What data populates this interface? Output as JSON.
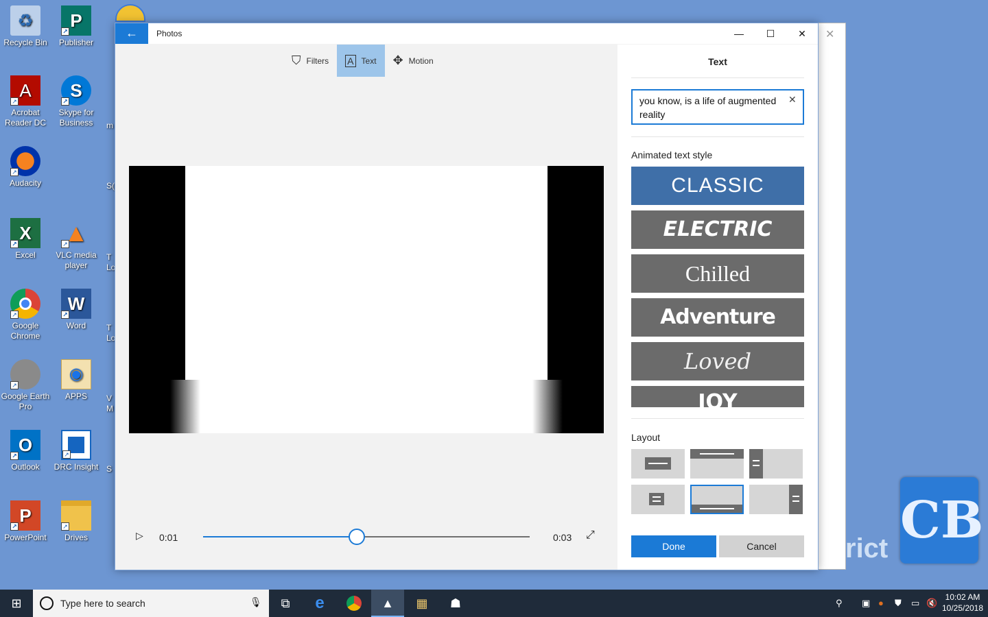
{
  "desktop": {
    "icons": [
      {
        "label": "Recycle Bin",
        "glyph": "♻",
        "color": "#9fb8d8"
      },
      {
        "label": "Publisher",
        "glyph": "P",
        "color": "#077568"
      },
      {
        "label": "Acrobat Reader DC",
        "glyph": "A",
        "color": "#b30b00"
      },
      {
        "label": "Skype for Business",
        "glyph": "S",
        "color": "#0078d7"
      },
      {
        "label": "Audacity",
        "glyph": "♫",
        "color": "#f2b705"
      },
      {
        "label": "Excel",
        "glyph": "X",
        "color": "#1d6f42"
      },
      {
        "label": "VLC media player",
        "glyph": "▲",
        "color": "#f58220"
      },
      {
        "label": "Google Chrome",
        "glyph": "◉",
        "color": "#db4437"
      },
      {
        "label": "Word",
        "glyph": "W",
        "color": "#2b579a"
      },
      {
        "label": "Google Earth Pro",
        "glyph": "◐",
        "color": "#8a8a8a"
      },
      {
        "label": "APPS",
        "glyph": "▦",
        "color": "#e8c36a"
      },
      {
        "label": "Outlook",
        "glyph": "O",
        "color": "#0072c6"
      },
      {
        "label": "DRC Insight",
        "glyph": "▤",
        "color": "#1565c0"
      },
      {
        "label": "PowerPoint",
        "glyph": "P",
        "color": "#d24726"
      },
      {
        "label": "Drives",
        "glyph": "▭",
        "color": "#f0c24b"
      }
    ],
    "partial_labels": [
      "m",
      "S(",
      "T\nLo",
      "T\nLo",
      "V\nM",
      "S"
    ],
    "watermark_logo": "CB",
    "watermark_text": "rict"
  },
  "window": {
    "title": "Photos",
    "back_glyph": "←",
    "minimize": "—",
    "maximize": "☐",
    "close": "✕",
    "background_close": "✕"
  },
  "toolbar": {
    "filters": "Filters",
    "text": "Text",
    "motion": "Motion",
    "filters_glyph": "⛉",
    "text_glyph": "A",
    "motion_glyph": "✥"
  },
  "player": {
    "play_glyph": "▷",
    "current_time": "0:01",
    "end_time": "0:03",
    "progress": 0.47,
    "fullscreen_glyph": "⤢"
  },
  "panel": {
    "title": "Text",
    "text_value": "you know, is a life of augmented reality",
    "clear_glyph": "✕",
    "animated_label": "Animated text style",
    "styles": [
      "CLASSIC",
      "ELECTRIC",
      "Chilled",
      "Adventure",
      "Loved",
      "JOY"
    ],
    "selected_style": 0,
    "layout_label": "Layout",
    "selected_layout": 4,
    "done": "Done",
    "cancel": "Cancel"
  },
  "colors": {
    "accent": "#1b7ad6",
    "desktop": "#6d96d2",
    "taskbar": "#1f2b3a"
  },
  "taskbar": {
    "start_glyph": "⊞",
    "search_placeholder": "Type here to search",
    "mic_glyph": "🎙",
    "items": [
      "task-view",
      "edge",
      "chrome",
      "photos",
      "movie-maker",
      "people-app"
    ],
    "tray_glyphs": [
      "⚲",
      "▣",
      "●",
      "⛊",
      "▭",
      "🔇"
    ],
    "time": "10:02 AM",
    "date": "10/25/2018"
  }
}
